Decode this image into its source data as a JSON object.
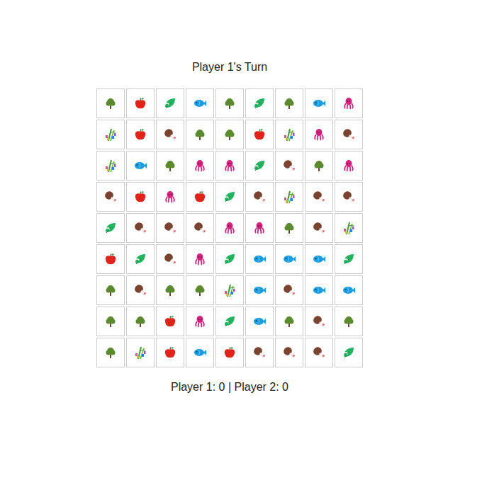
{
  "title": "Player 1's Turn",
  "board": [
    [
      {
        "kind": "tree"
      },
      {
        "kind": "apple"
      },
      {
        "kind": "leaf"
      },
      {
        "kind": "fish"
      },
      {
        "kind": "tree"
      },
      {
        "kind": "leaf"
      },
      {
        "kind": "tree"
      },
      {
        "kind": "fish"
      },
      {
        "kind": "octopus"
      }
    ],
    [
      {
        "kind": "bamboo"
      },
      {
        "kind": "apple"
      },
      {
        "kind": "meat"
      },
      {
        "kind": "tree"
      },
      {
        "kind": "tree"
      },
      {
        "kind": "apple"
      },
      {
        "kind": "bamboo"
      },
      {
        "kind": "octopus"
      },
      {
        "kind": "meat"
      }
    ],
    [
      {
        "kind": "bamboo"
      },
      {
        "kind": "fish"
      },
      {
        "kind": "tree"
      },
      {
        "kind": "octopus"
      },
      {
        "kind": "octopus"
      },
      {
        "kind": "leaf"
      },
      {
        "kind": "meat"
      },
      {
        "kind": "tree"
      },
      {
        "kind": "octopus"
      }
    ],
    [
      {
        "kind": "meat"
      },
      {
        "kind": "apple"
      },
      {
        "kind": "octopus"
      },
      {
        "kind": "apple"
      },
      {
        "kind": "leaf"
      },
      {
        "kind": "meat"
      },
      {
        "kind": "bamboo"
      },
      {
        "kind": "meat"
      },
      {
        "kind": "meat"
      }
    ],
    [
      {
        "kind": "leaf"
      },
      {
        "kind": "meat"
      },
      {
        "kind": "meat"
      },
      {
        "kind": "meat"
      },
      {
        "kind": "octopus"
      },
      {
        "kind": "octopus"
      },
      {
        "kind": "tree"
      },
      {
        "kind": "meat"
      },
      {
        "kind": "bamboo"
      }
    ],
    [
      {
        "kind": "apple"
      },
      {
        "kind": "leaf"
      },
      {
        "kind": "meat"
      },
      {
        "kind": "octopus"
      },
      {
        "kind": "leaf"
      },
      {
        "kind": "fish"
      },
      {
        "kind": "fish"
      },
      {
        "kind": "fish"
      },
      {
        "kind": "leaf"
      }
    ],
    [
      {
        "kind": "tree"
      },
      {
        "kind": "meat"
      },
      {
        "kind": "tree"
      },
      {
        "kind": "tree"
      },
      {
        "kind": "bamboo"
      },
      {
        "kind": "fish"
      },
      {
        "kind": "meat"
      },
      {
        "kind": "fish"
      },
      {
        "kind": "fish"
      }
    ],
    [
      {
        "kind": "tree"
      },
      {
        "kind": "tree"
      },
      {
        "kind": "apple"
      },
      {
        "kind": "octopus"
      },
      {
        "kind": "leaf"
      },
      {
        "kind": "fish"
      },
      {
        "kind": "tree"
      },
      {
        "kind": "meat"
      },
      {
        "kind": "tree"
      }
    ],
    [
      {
        "kind": "tree"
      },
      {
        "kind": "bamboo"
      },
      {
        "kind": "apple"
      },
      {
        "kind": "fish"
      },
      {
        "kind": "apple"
      },
      {
        "kind": "meat"
      },
      {
        "kind": "meat"
      },
      {
        "kind": "meat"
      },
      {
        "kind": "leaf"
      }
    ]
  ],
  "score": "Player 1: 0 | Player 2: 0"
}
